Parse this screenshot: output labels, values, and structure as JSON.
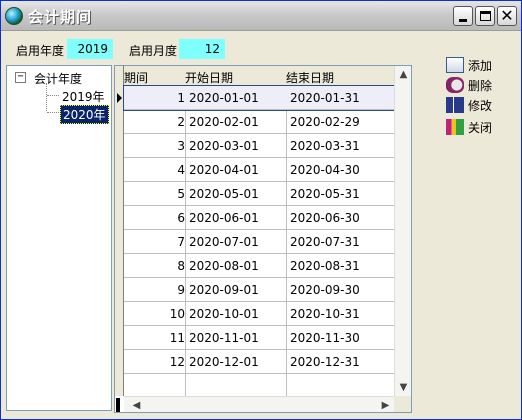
{
  "window": {
    "title": "会计期间"
  },
  "params": {
    "start_year_label": "启用年度",
    "start_year_value": "2019",
    "start_month_label": "启用月度",
    "start_month_value": "12"
  },
  "tree": {
    "expander": "−",
    "root_label": "会计年度",
    "children": [
      "2019年",
      "2020年"
    ]
  },
  "grid": {
    "columns": [
      "期间",
      "开始日期",
      "结束日期"
    ],
    "rows": [
      {
        "period": "1",
        "start": "2020-01-01",
        "end": "2020-01-31"
      },
      {
        "period": "2",
        "start": "2020-02-01",
        "end": "2020-02-29"
      },
      {
        "period": "3",
        "start": "2020-03-01",
        "end": "2020-03-31"
      },
      {
        "period": "4",
        "start": "2020-04-01",
        "end": "2020-04-30"
      },
      {
        "period": "5",
        "start": "2020-05-01",
        "end": "2020-05-31"
      },
      {
        "period": "6",
        "start": "2020-06-01",
        "end": "2020-06-30"
      },
      {
        "period": "7",
        "start": "2020-07-01",
        "end": "2020-07-31"
      },
      {
        "period": "8",
        "start": "2020-08-01",
        "end": "2020-08-31"
      },
      {
        "period": "9",
        "start": "2020-09-01",
        "end": "2020-09-30"
      },
      {
        "period": "10",
        "start": "2020-10-01",
        "end": "2020-10-31"
      },
      {
        "period": "11",
        "start": "2020-11-01",
        "end": "2020-11-30"
      },
      {
        "period": "12",
        "start": "2020-12-01",
        "end": "2020-12-31"
      }
    ]
  },
  "actions": {
    "add": "添加",
    "delete": "删除",
    "edit": "修改",
    "close": "关闭"
  },
  "icons": {
    "scroll_up": "▲",
    "scroll_down": "▼",
    "scroll_left": "◀",
    "scroll_right": "▶",
    "close_glyph": "✕"
  }
}
